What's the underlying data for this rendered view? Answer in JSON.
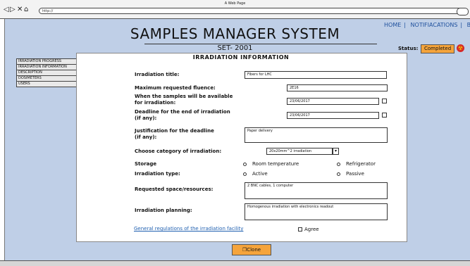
{
  "window": {
    "title": "A Web Page",
    "url": "http://"
  },
  "app": {
    "title": "SAMPLES MANAGER SYSTEM",
    "nav": [
      "HOME",
      "NOTIFIACATIONS",
      "BP"
    ],
    "set_id": "SET- 2001",
    "status_label": "Status:",
    "status_value": "Completed"
  },
  "sidebar": {
    "items": [
      {
        "label": "IRRADIATION PROGRESS"
      },
      {
        "label": "IRRADIATION INFORMATION"
      },
      {
        "label": "DESCRIPTION"
      },
      {
        "label": "DOSIMETERS"
      },
      {
        "label": "USERS"
      }
    ]
  },
  "panel": {
    "title": "IRRADIATION INFORMATION",
    "fields": {
      "irradiation_title": {
        "label": "Irradiation title:",
        "value": "Fibers for LHC"
      },
      "max_fluence": {
        "label": "Maximum requested fluence:",
        "value": "2E16"
      },
      "available_date": {
        "label_line1": "When the samples will be available",
        "label_line2": " for irradiation:",
        "value": "23/06/2017"
      },
      "deadline": {
        "label_line1": "Deadline for the end of irradiation",
        "label_line2": "(if any):",
        "value": "23/06/2017"
      },
      "justification": {
        "label_line1": "Justification for the deadline",
        "label_line2": "(if any):",
        "value": "Paper delivery"
      },
      "category": {
        "label": "Choose category of irradiation:",
        "value": "20x20mm^2 irradiation"
      },
      "storage": {
        "label": "Storage",
        "options": [
          "Room temperature",
          "Refrigerator"
        ]
      },
      "irradiation_type": {
        "label": "Irradiation type:",
        "options": [
          "Active",
          "Passive"
        ]
      },
      "space": {
        "label": "Requested space/resources:",
        "value": "2 BNC cables, 1 computer"
      },
      "planning": {
        "label": "Irradiation planning:",
        "value": "Homogenous irradiation with electronics readout"
      }
    },
    "regulations_link": "General regulations of the irradiation facility",
    "agree_label": "Agree",
    "clone_label": "Clone"
  }
}
